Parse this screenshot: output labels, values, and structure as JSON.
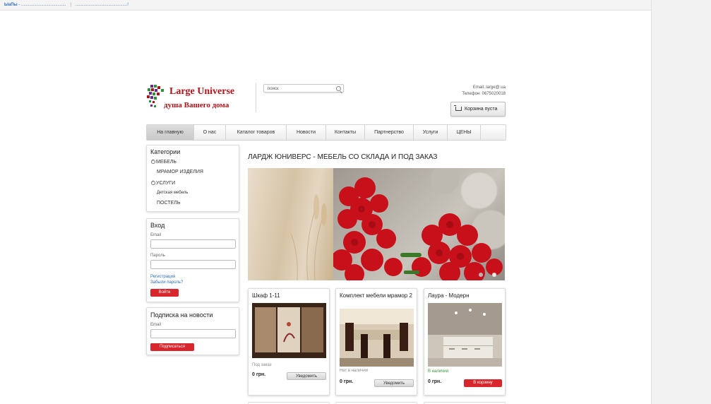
{
  "topbar": {
    "brand": "ЫаПы",
    "link1": " - ......................................",
    "link2": "............................................!"
  },
  "logo": {
    "title": "Large Universe",
    "subtitle": "душа Вашего дома"
  },
  "search": {
    "value": "поиск"
  },
  "contacts": {
    "email": "Email: large@.ua",
    "phone": "Телефон: 0675020018"
  },
  "cart": {
    "label": "Корзина пуста"
  },
  "nav": {
    "items": [
      "На главную",
      "О нас",
      "Каталог товаров",
      "Новости",
      "Контакты",
      "Партнерство",
      "Услуги",
      "ЦЕНЫ"
    ]
  },
  "categories": {
    "title": "Категории",
    "items": [
      "МЕБЕЛЬ",
      "МРАМОР ИЗДЕЛИЯ",
      "УСЛУГИ",
      "Детская мебель",
      "ПОСТЕЛЬ"
    ]
  },
  "login": {
    "title": "Вход",
    "email_label": "Email",
    "password_label": "Пароль",
    "register_link": "Регистрация",
    "forgot_link": "Забыли пароль?",
    "submit_label": "Войти"
  },
  "newsletter": {
    "title": "Подписка на новости",
    "email_label": "Email",
    "submit_label": "Подписаться"
  },
  "main": {
    "title": "ЛАРДЖ ЮНИВЕРС - МЕБЕЛЬ СО СКЛАДА И ПОД ЗАКАЗ"
  },
  "products": [
    {
      "title": "Шкаф 1-11",
      "availability": "Под заказ",
      "price": "0 грн.",
      "button": "Уведомить"
    },
    {
      "title": "Комплект мебели мрамор 2",
      "availability": "Нет в наличии",
      "price": "0 грн.",
      "button": "Уведомить"
    },
    {
      "title": "Лаура - Модерн",
      "availability": "В наличии",
      "price": "0 грн.",
      "button": "В корзину"
    }
  ],
  "colors": {
    "accent_red": "#d9252c",
    "link_blue": "#2a6ebb",
    "brand_red": "#b01218",
    "in_stock_green": "#3a9a3a"
  }
}
